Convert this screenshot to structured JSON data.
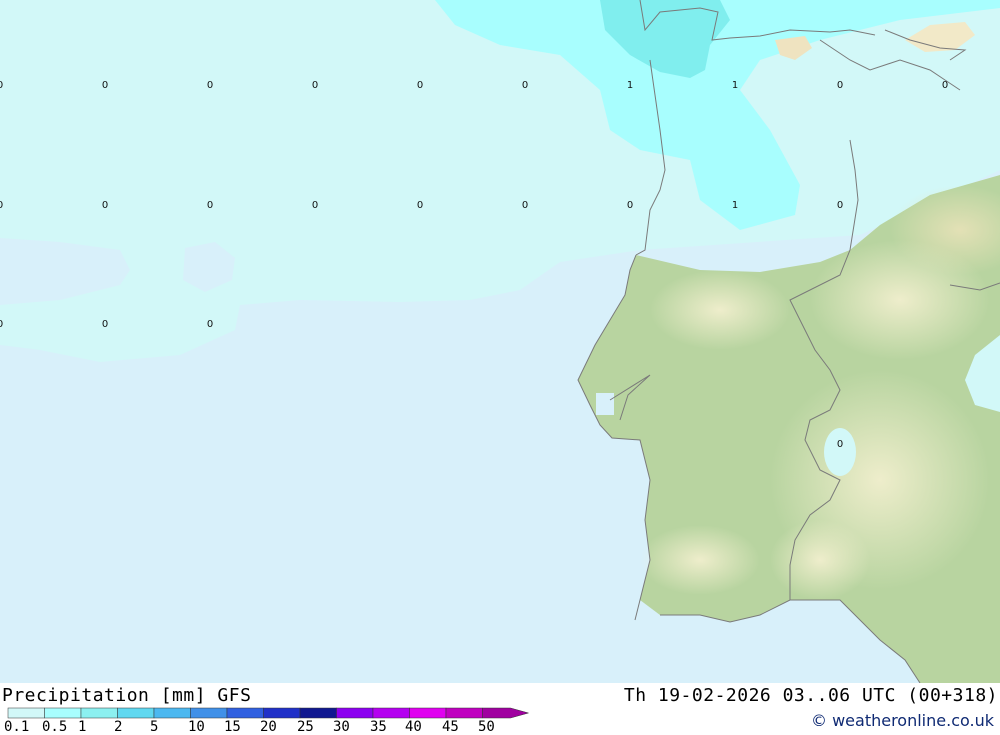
{
  "map": {
    "grid_values": [
      {
        "row": 1,
        "values": [
          "0",
          "0",
          "0",
          "0",
          "0",
          "0",
          "1",
          "1",
          "0",
          "0"
        ]
      },
      {
        "row": 2,
        "values": [
          "0",
          "0",
          "0",
          "0",
          "0",
          "0",
          "0",
          "1",
          "0"
        ]
      },
      {
        "row": 3,
        "values": [
          "0",
          "0",
          "0"
        ]
      },
      {
        "row": 4,
        "values": [
          "0"
        ]
      }
    ],
    "colors": {
      "sea": "#d8f0fa",
      "precip_light": "#d2f8f8",
      "precip_medium": "#a8fefe",
      "precip_heavy": "#80eeee",
      "land": "#b8d4a0",
      "land_highland": "#f0ecc8",
      "border": "#7a7a7a"
    }
  },
  "footer": {
    "title": "Precipitation [mm] GFS",
    "validity": "Th 19-02-2026 03..06 UTC (00+318)",
    "credit": "© weatheronline.co.uk"
  },
  "legend": {
    "labels": [
      "0.1",
      "0.5",
      "1",
      "2",
      "5",
      "10",
      "15",
      "20",
      "25",
      "30",
      "35",
      "40",
      "45",
      "50"
    ],
    "colors": [
      "#d2f8f8",
      "#a8fefe",
      "#8cf0f0",
      "#60d8f0",
      "#4cb8f0",
      "#4090e8",
      "#3060e0",
      "#2030c8",
      "#101890",
      "#8c00f0",
      "#b400f0",
      "#e000f0",
      "#c000c0",
      "#a000a0"
    ]
  }
}
